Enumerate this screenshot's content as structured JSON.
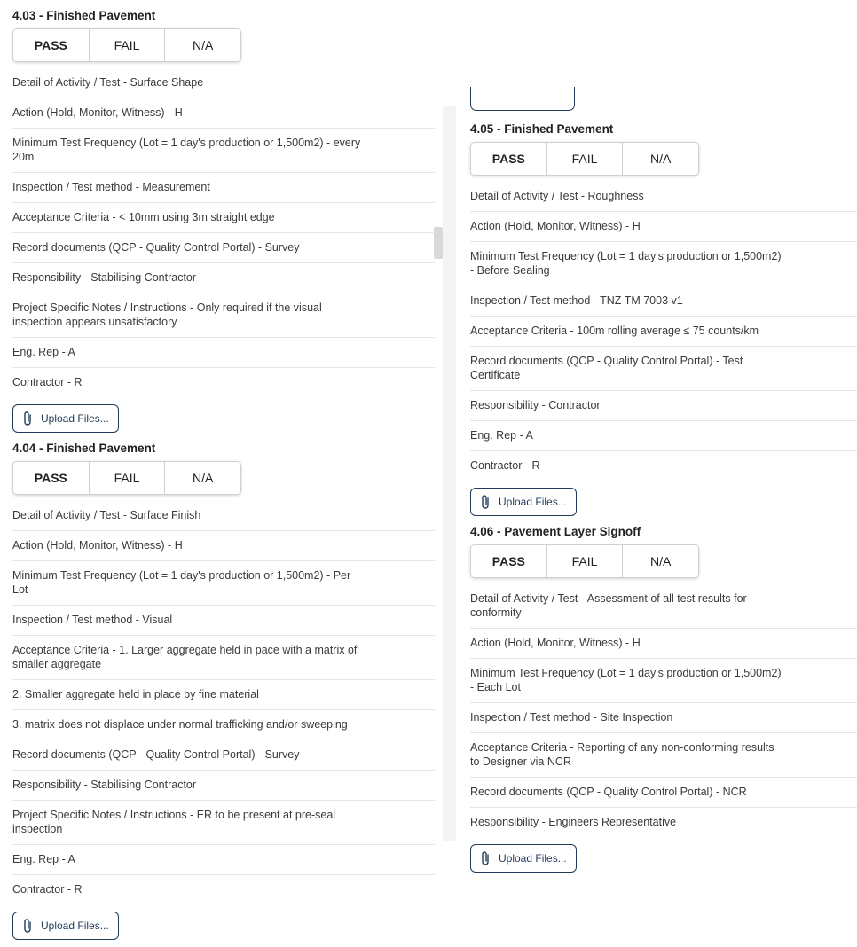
{
  "buttons": {
    "pass": "PASS",
    "fail": "FAIL",
    "na": "N/A",
    "upload": "Upload Files..."
  },
  "sections": {
    "s403": {
      "title": "4.03 - Finished Pavement",
      "rows": [
        "Detail of Activity / Test - Surface Shape",
        "Action (Hold, Monitor, Witness) - H",
        "Minimum Test Frequency (Lot = 1 day's production or 1,500m2) - every 20m",
        "Inspection / Test method - Measurement",
        "Acceptance Criteria - < 10mm using 3m straight edge",
        "Record documents (QCP - Quality Control Portal) - Survey",
        "Responsibility - Stabilising Contractor",
        "Project Specific Notes / Instructions - Only required if the visual inspection appears unsatisfactory",
        "Eng. Rep - A",
        "Contractor - R"
      ]
    },
    "s404": {
      "title": "4.04 - Finished Pavement",
      "rows": [
        "Detail of Activity / Test - Surface Finish",
        "Action (Hold, Monitor, Witness) - H",
        "Minimum Test Frequency (Lot = 1 day's production or 1,500m2) - Per Lot",
        "Inspection / Test method - Visual",
        "Acceptance Criteria - 1. Larger aggregate held in pace with a matrix of smaller aggregate",
        "2. Smaller aggregate held in place by fine material",
        "3. matrix does not displace under normal trafficking and/or sweeping",
        "Record documents (QCP - Quality Control Portal) - Survey",
        "Responsibility - Stabilising Contractor",
        "Project Specific Notes / Instructions - ER to be present at pre-seal inspection",
        "Eng. Rep - A",
        "Contractor - R"
      ]
    },
    "s405": {
      "title": "4.05 - Finished Pavement",
      "rows": [
        "Detail of Activity / Test - Roughness",
        "Action (Hold, Monitor, Witness) - H",
        "Minimum Test Frequency (Lot = 1 day's production or 1,500m2) - Before Sealing",
        "Inspection / Test method - TNZ TM 7003 v1",
        "Acceptance Criteria - 100m rolling average ≤ 75 counts/km",
        "Record documents (QCP - Quality Control Portal) - Test Certificate",
        "Responsibility - Contractor",
        "Eng. Rep - A",
        "Contractor - R"
      ]
    },
    "s406": {
      "title": "4.06 - Pavement Layer Signoff",
      "rows": [
        "Detail of Activity / Test - Assessment of all test results for conformity",
        "Action (Hold, Monitor, Witness) - H",
        "Minimum Test Frequency (Lot = 1 day's production or 1,500m2) - Each Lot",
        "Inspection / Test method - Site Inspection",
        "Acceptance Criteria - Reporting of any non-conforming results to Designer via NCR",
        "Record documents (QCP - Quality Control Portal) - NCR",
        "Responsibility - Engineers Representative"
      ]
    }
  },
  "icons": {
    "upload": "paperclip-icon"
  },
  "colors": {
    "upload_border": "#1f3b5b",
    "divider": "#e6e6e6"
  }
}
